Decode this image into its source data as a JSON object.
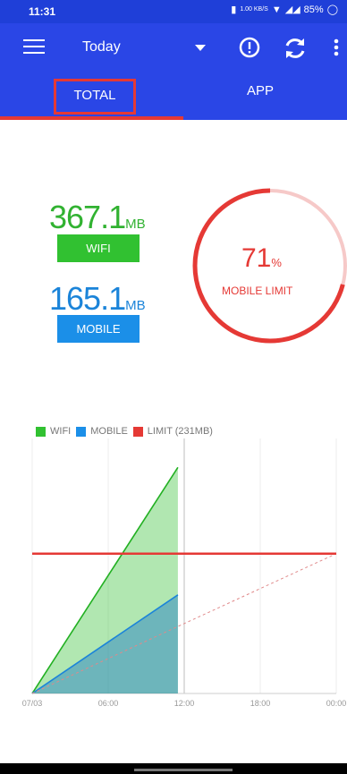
{
  "status_bar": {
    "time": "11:31",
    "data_speed": "1.00 KB/S",
    "battery": "85%"
  },
  "toolbar": {
    "period": "Today"
  },
  "tabs": {
    "total": "TOTAL",
    "app": "APP"
  },
  "summary": {
    "wifi_amount": "367.1",
    "wifi_unit": "MB",
    "wifi_label": "WIFI",
    "mobile_amount": "165.1",
    "mobile_unit": "MB",
    "mobile_label": "MOBILE"
  },
  "gauge": {
    "percent_value": "71",
    "percent_sign": "%",
    "label": "MOBILE LIMIT",
    "fraction": 0.71
  },
  "legend": {
    "wifi": "WIFI",
    "mobile": "MOBILE",
    "limit": "LIMIT (231MB)"
  },
  "colors": {
    "wifi": "#31c131",
    "mobile": "#1b8fe8",
    "limit": "#e53935",
    "appbar": "#2a46e6"
  },
  "chart_data": {
    "type": "area",
    "x_ticks": [
      "07/03",
      "06:00",
      "12:00",
      "18:00",
      "00:00"
    ],
    "xlim_hours": [
      0,
      24
    ],
    "ylim_mb": [
      0,
      600
    ],
    "series": [
      {
        "name": "WIFI",
        "x_hours": [
          0,
          11.5
        ],
        "y_mb": [
          0,
          532
        ]
      },
      {
        "name": "MOBILE",
        "x_hours": [
          0,
          11.5
        ],
        "y_mb": [
          0,
          232
        ]
      },
      {
        "name": "LIMIT (231MB)",
        "x_hours": [
          0,
          24
        ],
        "y_mb": [
          329,
          329
        ]
      }
    ],
    "projection": {
      "x_hours": [
        0,
        24
      ],
      "y_mb": [
        0,
        329
      ]
    },
    "current_time_hours": 12,
    "grid": "vertical"
  }
}
